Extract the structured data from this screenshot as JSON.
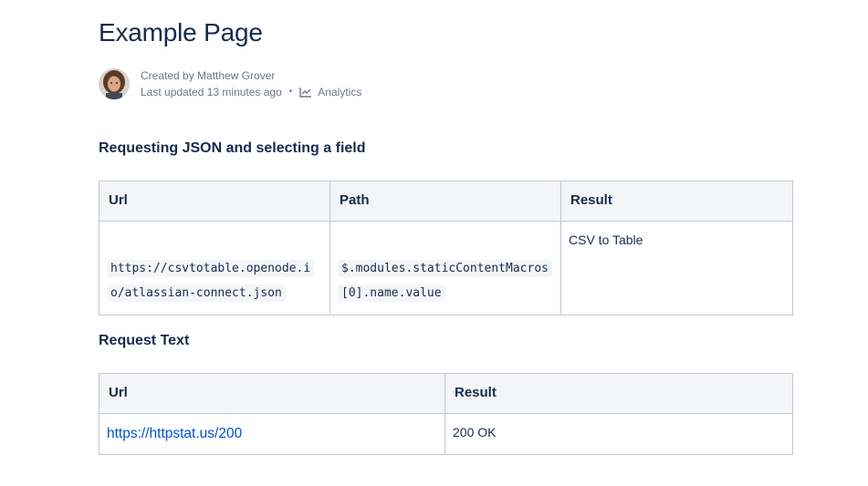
{
  "page": {
    "title": "Example Page"
  },
  "byline": {
    "created_by": "Created by Matthew Grover",
    "last_updated": "Last updated 13 minutes ago",
    "separator": "•",
    "analytics_label": "Analytics",
    "analytics_icon": "chart-line-icon"
  },
  "sections": {
    "json": {
      "heading": "Requesting JSON and selecting a field",
      "headers": [
        "Url",
        "Path",
        "Result"
      ],
      "row": {
        "url": "https://csvtotable.openode.io/atlassian-connect.json",
        "path": "$.modules.staticContentMacros[0].name.value",
        "result": "CSV to Table"
      }
    },
    "text": {
      "heading": "Request Text",
      "headers": [
        "Url",
        "Result"
      ],
      "row": {
        "url": "https://httpstat.us/200",
        "result": "200 OK"
      }
    }
  },
  "colors": {
    "text": "#172b4d",
    "subtle": "#6b778c",
    "link": "#0052cc",
    "header_bg": "#f4f5f7",
    "border": "#c1c7d0"
  }
}
